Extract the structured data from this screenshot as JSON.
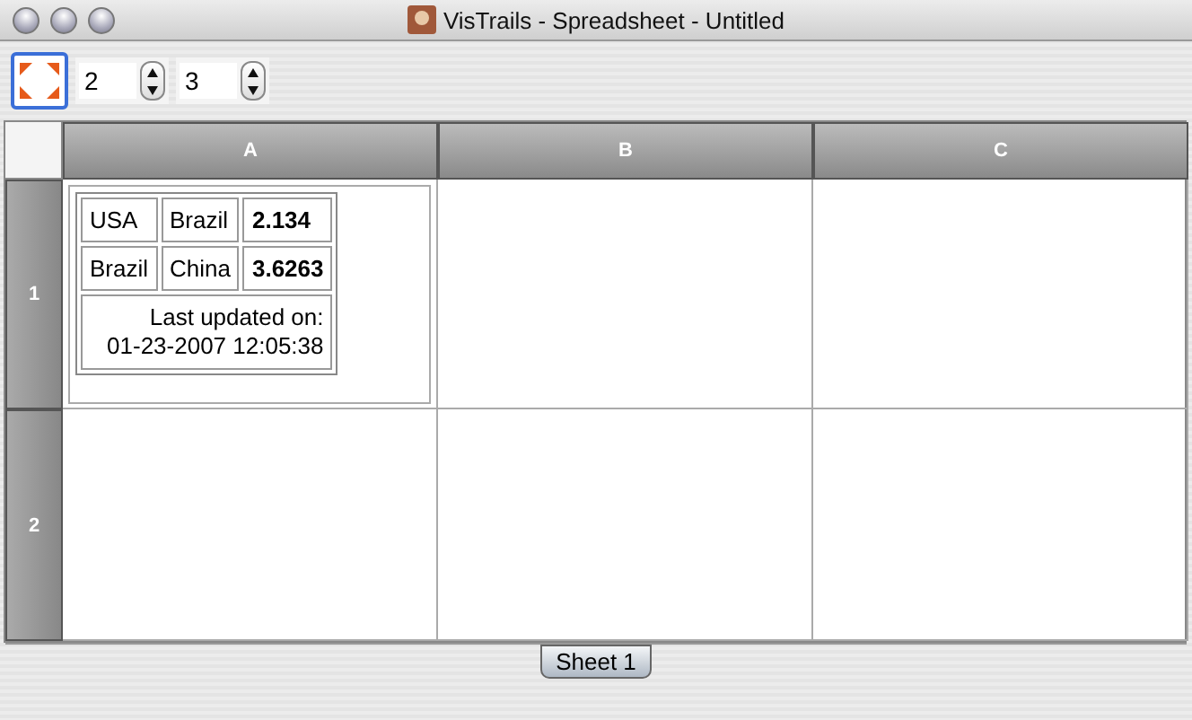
{
  "window": {
    "title": "VisTrails - Spreadsheet - Untitled"
  },
  "toolbar": {
    "rows": "2",
    "columns": "3"
  },
  "sheet": {
    "columns": [
      "A",
      "B",
      "C"
    ],
    "rows": [
      {
        "label": "1",
        "cells": [
          {
            "kind": "table",
            "rows": [
              [
                "USA",
                "Brazil",
                "2.134"
              ],
              [
                "Brazil",
                "China",
                "3.6263"
              ]
            ],
            "footer": [
              "Last updated on:",
              "01-23-2007 12:05:38"
            ]
          },
          {
            "kind": "empty"
          },
          {
            "kind": "empty"
          }
        ]
      },
      {
        "label": "2",
        "cells": [
          {
            "kind": "empty"
          },
          {
            "kind": "empty"
          },
          {
            "kind": "empty"
          }
        ]
      }
    ]
  },
  "tabs": [
    {
      "label": "Sheet 1",
      "selected": true
    }
  ]
}
